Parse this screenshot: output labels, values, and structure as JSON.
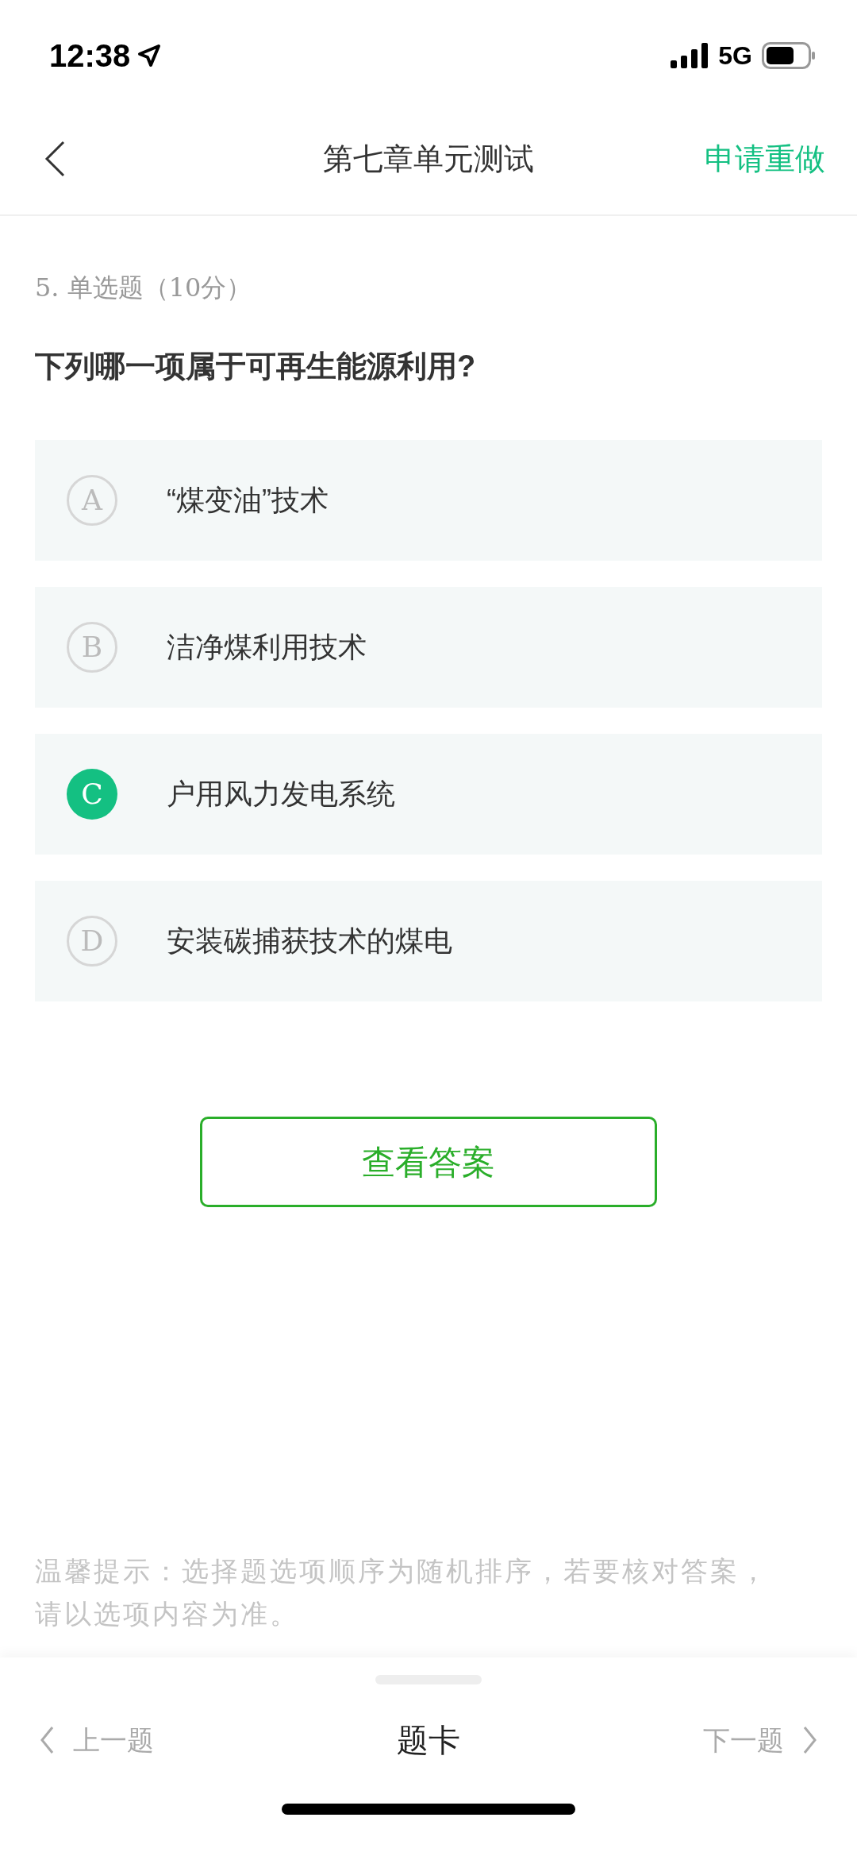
{
  "status_bar": {
    "time": "12:38",
    "network": "5G"
  },
  "header": {
    "title": "第七章单元测试",
    "action": "申请重做"
  },
  "question": {
    "meta": "5. 单选题（10分）",
    "text": "下列哪一项属于可再生能源利用?"
  },
  "options": [
    {
      "letter": "A",
      "text": "“煤变油”技术",
      "selected": false
    },
    {
      "letter": "B",
      "text": "洁净煤利用技术",
      "selected": false
    },
    {
      "letter": "C",
      "text": "户用风力发电系统",
      "selected": true
    },
    {
      "letter": "D",
      "text": "安装碳捕获技术的煤电",
      "selected": false
    }
  ],
  "answer_button": "查看答案",
  "hint": "温馨提示：选择题选项顺序为随机排序，若要核对答案，请以选项内容为准。",
  "bottom_nav": {
    "prev": "上一题",
    "center": "题卡",
    "next": "下一题"
  }
}
